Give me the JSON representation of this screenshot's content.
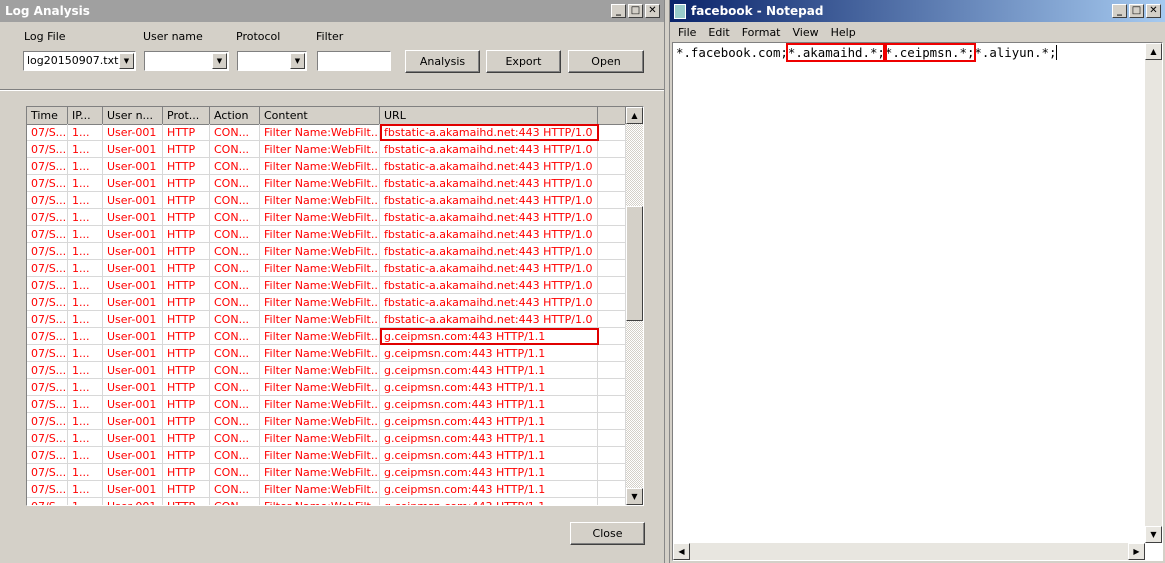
{
  "log_window": {
    "title": "Log Analysis",
    "labels": {
      "log_file": "Log File",
      "user_name": "User name",
      "protocol": "Protocol",
      "filter": "Filter"
    },
    "log_file_value": "log20150907.txt",
    "user_name_value": "",
    "protocol_value": "",
    "filter_value": "",
    "buttons": {
      "analysis": "Analysis",
      "export": "Export",
      "open": "Open",
      "close": "Close"
    },
    "columns": [
      "Time",
      "IP...",
      "User n...",
      "Prot...",
      "Action",
      "Content",
      "URL",
      ""
    ],
    "rows": [
      {
        "time": "07/S...",
        "ip": "1...",
        "user": "User-001",
        "prot": "HTTP",
        "action": "CON...",
        "content": "Filter Name:WebFilt...",
        "url": "fbstatic-a.akamaihd.net:443 HTTP/1.0",
        "highlight": true
      },
      {
        "time": "07/S...",
        "ip": "1...",
        "user": "User-001",
        "prot": "HTTP",
        "action": "CON...",
        "content": "Filter Name:WebFilt...",
        "url": "fbstatic-a.akamaihd.net:443 HTTP/1.0"
      },
      {
        "time": "07/S...",
        "ip": "1...",
        "user": "User-001",
        "prot": "HTTP",
        "action": "CON...",
        "content": "Filter Name:WebFilt...",
        "url": "fbstatic-a.akamaihd.net:443 HTTP/1.0"
      },
      {
        "time": "07/S...",
        "ip": "1...",
        "user": "User-001",
        "prot": "HTTP",
        "action": "CON...",
        "content": "Filter Name:WebFilt...",
        "url": "fbstatic-a.akamaihd.net:443 HTTP/1.0"
      },
      {
        "time": "07/S...",
        "ip": "1...",
        "user": "User-001",
        "prot": "HTTP",
        "action": "CON...",
        "content": "Filter Name:WebFilt...",
        "url": "fbstatic-a.akamaihd.net:443 HTTP/1.0"
      },
      {
        "time": "07/S...",
        "ip": "1...",
        "user": "User-001",
        "prot": "HTTP",
        "action": "CON...",
        "content": "Filter Name:WebFilt...",
        "url": "fbstatic-a.akamaihd.net:443 HTTP/1.0"
      },
      {
        "time": "07/S...",
        "ip": "1...",
        "user": "User-001",
        "prot": "HTTP",
        "action": "CON...",
        "content": "Filter Name:WebFilt...",
        "url": "fbstatic-a.akamaihd.net:443 HTTP/1.0"
      },
      {
        "time": "07/S...",
        "ip": "1...",
        "user": "User-001",
        "prot": "HTTP",
        "action": "CON...",
        "content": "Filter Name:WebFilt...",
        "url": "fbstatic-a.akamaihd.net:443 HTTP/1.0"
      },
      {
        "time": "07/S...",
        "ip": "1...",
        "user": "User-001",
        "prot": "HTTP",
        "action": "CON...",
        "content": "Filter Name:WebFilt...",
        "url": "fbstatic-a.akamaihd.net:443 HTTP/1.0"
      },
      {
        "time": "07/S...",
        "ip": "1...",
        "user": "User-001",
        "prot": "HTTP",
        "action": "CON...",
        "content": "Filter Name:WebFilt...",
        "url": "fbstatic-a.akamaihd.net:443 HTTP/1.0"
      },
      {
        "time": "07/S...",
        "ip": "1...",
        "user": "User-001",
        "prot": "HTTP",
        "action": "CON...",
        "content": "Filter Name:WebFilt...",
        "url": "fbstatic-a.akamaihd.net:443 HTTP/1.0"
      },
      {
        "time": "07/S...",
        "ip": "1...",
        "user": "User-001",
        "prot": "HTTP",
        "action": "CON...",
        "content": "Filter Name:WebFilt...",
        "url": "fbstatic-a.akamaihd.net:443 HTTP/1.0"
      },
      {
        "time": "07/S...",
        "ip": "1...",
        "user": "User-001",
        "prot": "HTTP",
        "action": "CON...",
        "content": "Filter Name:WebFilt...",
        "url": "g.ceipmsn.com:443 HTTP/1.1",
        "highlight": true
      },
      {
        "time": "07/S...",
        "ip": "1...",
        "user": "User-001",
        "prot": "HTTP",
        "action": "CON...",
        "content": "Filter Name:WebFilt...",
        "url": "g.ceipmsn.com:443 HTTP/1.1"
      },
      {
        "time": "07/S...",
        "ip": "1...",
        "user": "User-001",
        "prot": "HTTP",
        "action": "CON...",
        "content": "Filter Name:WebFilt...",
        "url": "g.ceipmsn.com:443 HTTP/1.1"
      },
      {
        "time": "07/S...",
        "ip": "1...",
        "user": "User-001",
        "prot": "HTTP",
        "action": "CON...",
        "content": "Filter Name:WebFilt...",
        "url": "g.ceipmsn.com:443 HTTP/1.1"
      },
      {
        "time": "07/S...",
        "ip": "1...",
        "user": "User-001",
        "prot": "HTTP",
        "action": "CON...",
        "content": "Filter Name:WebFilt...",
        "url": "g.ceipmsn.com:443 HTTP/1.1"
      },
      {
        "time": "07/S...",
        "ip": "1...",
        "user": "User-001",
        "prot": "HTTP",
        "action": "CON...",
        "content": "Filter Name:WebFilt...",
        "url": "g.ceipmsn.com:443 HTTP/1.1"
      },
      {
        "time": "07/S...",
        "ip": "1...",
        "user": "User-001",
        "prot": "HTTP",
        "action": "CON...",
        "content": "Filter Name:WebFilt...",
        "url": "g.ceipmsn.com:443 HTTP/1.1"
      },
      {
        "time": "07/S...",
        "ip": "1...",
        "user": "User-001",
        "prot": "HTTP",
        "action": "CON...",
        "content": "Filter Name:WebFilt...",
        "url": "g.ceipmsn.com:443 HTTP/1.1"
      },
      {
        "time": "07/S...",
        "ip": "1...",
        "user": "User-001",
        "prot": "HTTP",
        "action": "CON...",
        "content": "Filter Name:WebFilt...",
        "url": "g.ceipmsn.com:443 HTTP/1.1"
      },
      {
        "time": "07/S...",
        "ip": "1...",
        "user": "User-001",
        "prot": "HTTP",
        "action": "CON...",
        "content": "Filter Name:WebFilt...",
        "url": "g.ceipmsn.com:443 HTTP/1.1"
      },
      {
        "time": "07/S...",
        "ip": "1...",
        "user": "User-001",
        "prot": "HTTP",
        "action": "CON...",
        "content": "Filter Name:WebFilt...",
        "url": "g.ceipmsn.com:443 HTTP/1.1"
      }
    ],
    "scroll_fraction": 0.33,
    "row_text_color": "#ff0000",
    "highlight_color": "#e00000"
  },
  "notepad": {
    "title": "facebook - Notepad",
    "menu": [
      "File",
      "Edit",
      "Format",
      "View",
      "Help"
    ],
    "segments": [
      {
        "text": "*.facebook.com;",
        "boxed": false
      },
      {
        "text": "*.akamaihd.*;",
        "boxed": true
      },
      {
        "text": "*.ceipmsn.*;",
        "boxed": true
      },
      {
        "text": "*.aliyun.*;",
        "boxed": false
      }
    ]
  }
}
